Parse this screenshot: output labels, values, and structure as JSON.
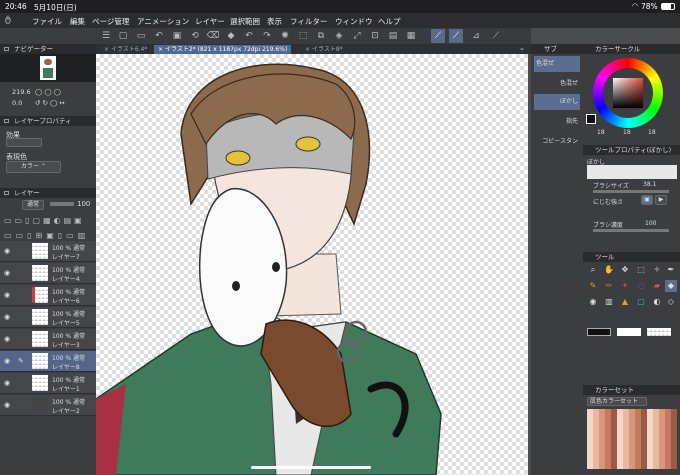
{
  "status": {
    "time": "20:46",
    "date": "5月10日(日)",
    "battery": "78%"
  },
  "menu": [
    "ファイル",
    "編集",
    "ページ管理",
    "アニメーション",
    "レイヤー",
    "選択範囲",
    "表示",
    "フィルター",
    "ウィンドウ",
    "ヘルプ"
  ],
  "tabs": [
    {
      "label": "イラスト6.4*",
      "active": false
    },
    {
      "label": "イラスト2* (821 x 1187px 72dpi 219.6%)",
      "active": true
    },
    {
      "label": "イラスト8*",
      "active": false
    }
  ],
  "navigator": {
    "title": "ナビゲーター",
    "zoom": "219.6",
    "zoom2": "0.0"
  },
  "layer_props": {
    "title": "レイヤープロパティ",
    "effect": "効果",
    "expression": "表現色",
    "color_mode": "カラー"
  },
  "layers_panel": {
    "title": "レイヤー",
    "blend": "通常",
    "opacity": "100"
  },
  "layers": [
    {
      "opacity": "100 %",
      "blend": "通常",
      "name": "レイヤー7",
      "selected": false
    },
    {
      "opacity": "100 %",
      "blend": "通常",
      "name": "レイヤー4",
      "selected": false
    },
    {
      "opacity": "100 %",
      "blend": "通常",
      "name": "レイヤー6",
      "selected": false
    },
    {
      "opacity": "100 %",
      "blend": "通常",
      "name": "レイヤー5",
      "selected": false
    },
    {
      "opacity": "100 %",
      "blend": "通常",
      "name": "レイヤー3",
      "selected": false
    },
    {
      "opacity": "100 %",
      "blend": "通常",
      "name": "レイヤー8",
      "selected": true
    },
    {
      "opacity": "100 %",
      "blend": "通常",
      "name": "レイヤー1",
      "selected": false
    },
    {
      "opacity": "100 %",
      "blend": "通常",
      "name": "レイヤー2",
      "selected": false
    }
  ],
  "subtool": {
    "title": "サブ",
    "items": [
      "色混ぜ",
      "色混ぜ",
      "ぼかし",
      "指先",
      "コピースタン"
    ]
  },
  "color_circle": {
    "title": "カラーサークル",
    "h": "18",
    "s": "18",
    "v": "18"
  },
  "tool_props": {
    "title": "ツールプロパティ(ぼかし)",
    "name": "ぼかし",
    "brush_size_label": "ブラシサイズ",
    "brush_size": "38.1",
    "blur_label": "にじむ強さ",
    "density_label": "ブラシ濃度",
    "density": "100"
  },
  "tool_panel": {
    "title": "ツール"
  },
  "color_set": {
    "title": "カラーセット",
    "name": "肌色カラーセット"
  },
  "colors": {
    "accent": "#4e6a94",
    "panel": "#3c3d41",
    "header": "#2a2b2e"
  }
}
